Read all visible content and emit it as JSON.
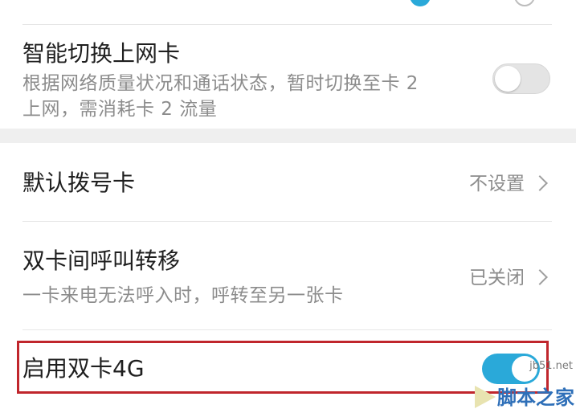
{
  "smart_switch": {
    "title": "智能切换上网卡",
    "desc_line1": "根据网络质量状况和通话状态，暂时切换至卡 2",
    "desc_line2": "上网，需消耗卡 2 流量",
    "enabled": false
  },
  "default_dial": {
    "title": "默认拨号卡",
    "value": "不设置"
  },
  "call_forward": {
    "title": "双卡间呼叫转移",
    "desc": "一卡来电无法呼入时，呼转至另一张卡",
    "value": "已关闭"
  },
  "dual_4g": {
    "title": "启用双卡4G",
    "enabled": true
  },
  "watermark": {
    "site": "jb51.net",
    "logo": "脚本之家"
  },
  "colors": {
    "accent": "#2aa9d9",
    "highlight": "#c0262c"
  }
}
